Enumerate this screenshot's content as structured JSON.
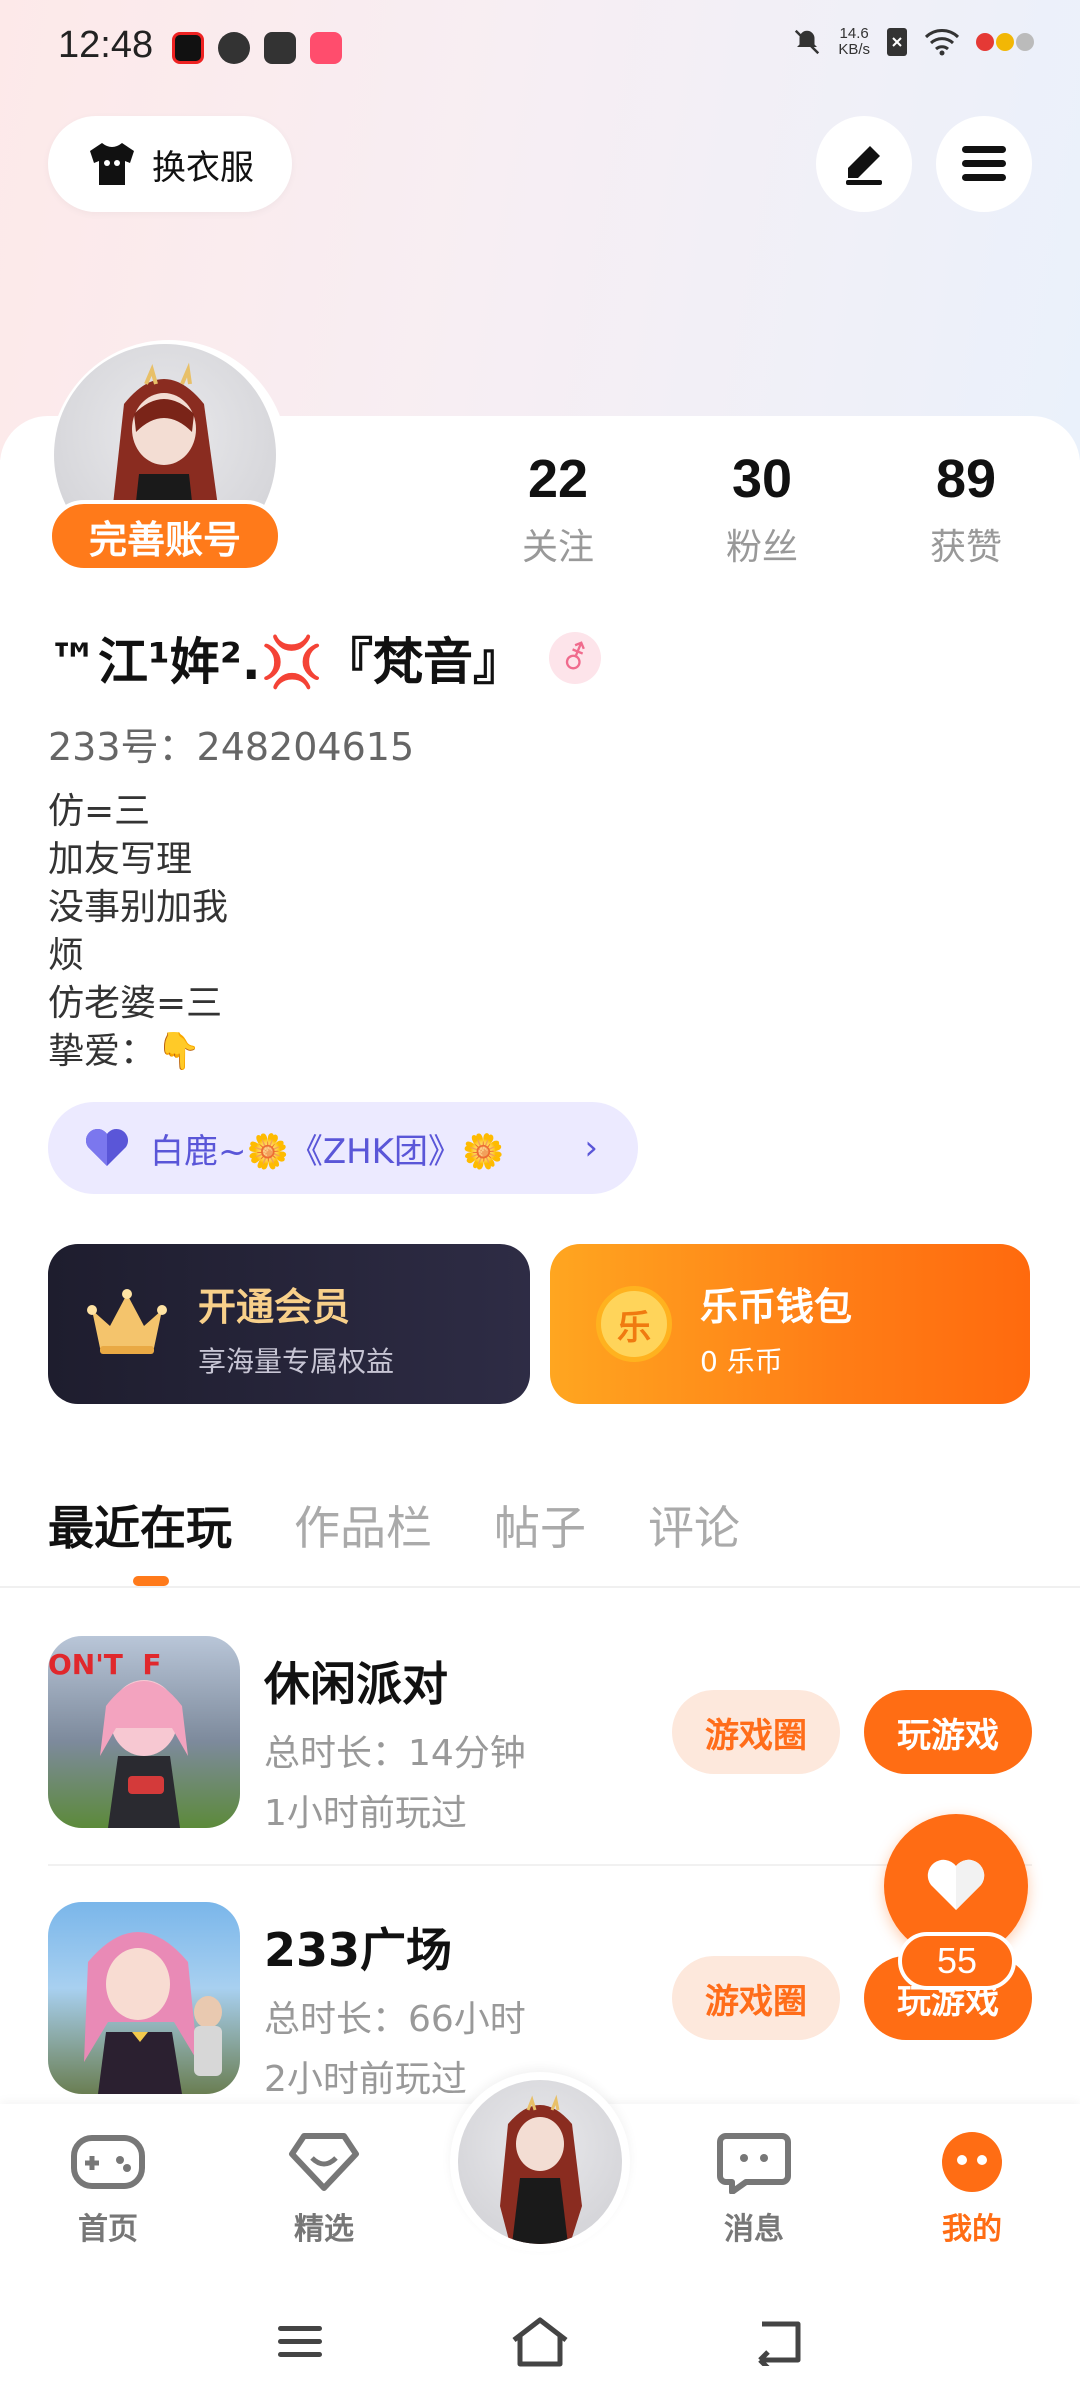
{
  "status_bar": {
    "time": "12:48",
    "net_speed_value": "14.6",
    "net_speed_unit": "KB/s",
    "icons": [
      "video-icon",
      "link-icon",
      "mail-icon",
      "app-icon",
      "mute-icon",
      "sim-icon",
      "wifi-icon"
    ]
  },
  "header": {
    "outfit_label": "换衣服",
    "edit_icon": "pen-icon",
    "menu_icon": "hamburger-icon"
  },
  "profile": {
    "complete_badge": "完善账号",
    "stats": [
      {
        "value": "22",
        "label": "关注"
      },
      {
        "value": "30",
        "label": "粉丝"
      },
      {
        "value": "89",
        "label": "获赞"
      }
    ],
    "nickname": "™江¹姩².💢『梵音』",
    "gender_symbol": "⚦",
    "uid": "233号：248204615",
    "bio_lines": [
      "仿=三",
      "加友写理",
      "没事别加我",
      "烦",
      "仿老婆=三",
      "挚爱："
    ],
    "bio_emoji": "👇",
    "group_chip": "白鹿~🌼《ZHK团》🌼"
  },
  "cards": {
    "vip_title": "开通会员",
    "vip_sub": "享海量专属权益",
    "coin_title": "乐币钱包",
    "coin_sub": "0 乐币",
    "coin_char": "乐"
  },
  "tabs": [
    "最近在玩",
    "作品栏",
    "帖子",
    "评论"
  ],
  "games": [
    {
      "title": "休闲派对",
      "duration": "总时长：14分钟",
      "last_played": "1小时前玩过",
      "circle_btn": "游戏圈",
      "play_btn": "玩游戏",
      "thumb_text": "ON'T  F"
    },
    {
      "title": "233广场",
      "duration": "总时长：66小时",
      "last_played": "2小时前玩过",
      "circle_btn": "游戏圈",
      "play_btn": "玩游戏"
    }
  ],
  "like_fab": {
    "count": "55"
  },
  "bottom_nav": [
    {
      "label": "首页",
      "icon": "gamepad-icon"
    },
    {
      "label": "精选",
      "icon": "heart-gem-icon"
    },
    {
      "label": "消息",
      "icon": "chat-icon"
    },
    {
      "label": "我的",
      "icon": "face-icon"
    }
  ],
  "colors": {
    "accent": "#ff6d14",
    "vip_gold": "#f8d08a",
    "chip_purple": "#5a56d8"
  }
}
